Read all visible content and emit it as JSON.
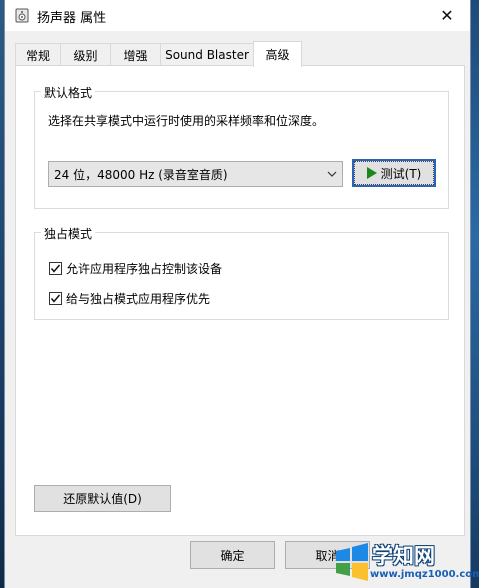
{
  "window": {
    "title": "扬声器 属性",
    "close_glyph": "✕"
  },
  "tabs": [
    {
      "label": "常规",
      "active": false
    },
    {
      "label": "级别",
      "active": false
    },
    {
      "label": "增强",
      "active": false
    },
    {
      "label": "Sound Blaster",
      "active": false
    },
    {
      "label": "高级",
      "active": true
    }
  ],
  "default_format": {
    "group_title": "默认格式",
    "description": "选择在共享模式中运行时使用的采样频率和位深度。",
    "selected_format": "24 位，48000 Hz (录音室音质)",
    "test_button": "测试(T)"
  },
  "exclusive_mode": {
    "group_title": "独占模式",
    "allow_exclusive": {
      "label": "允许应用程序独占控制该设备",
      "checked": true
    },
    "give_priority": {
      "label": "给与独占模式应用程序优先",
      "checked": true
    }
  },
  "restore_defaults_button": "还原默认值(D)",
  "footer": {
    "ok_button": "确定",
    "cancel_button": "取消"
  },
  "watermark": {
    "name": "学知网",
    "url": "www.jmqz1000.com"
  },
  "colors": {
    "default_button_border": "#2a63b8",
    "play_icon": "#1a8a1a"
  }
}
